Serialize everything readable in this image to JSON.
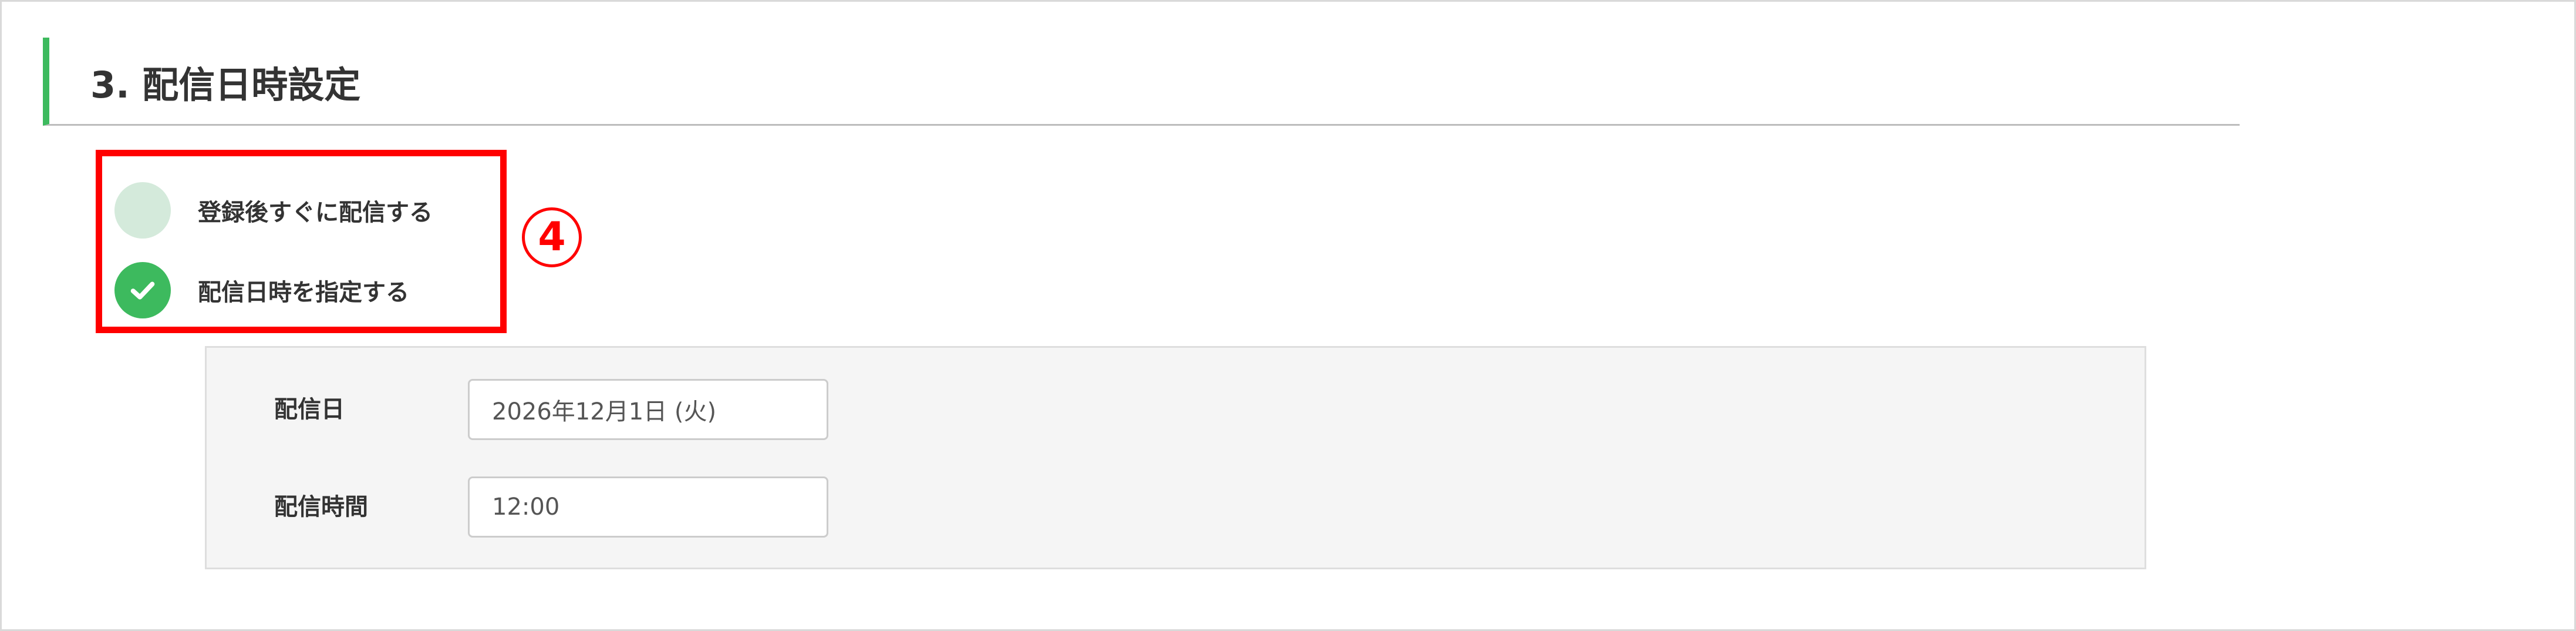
{
  "section": {
    "title": "3. 配信日時設定"
  },
  "delivery_options": [
    {
      "label": "登録後すぐに配信する",
      "selected": false
    },
    {
      "label": "配信日時を指定する",
      "selected": true
    }
  ],
  "annotation": {
    "marker": "④"
  },
  "schedule": {
    "date_label": "配信日",
    "date_value": "2026年12月1日 (火)",
    "time_label": "配信時間",
    "time_value": "12:00"
  },
  "colors": {
    "accent_green": "#3dba5e",
    "radio_unselected": "#d4eadb",
    "highlight_red": "#ff0000"
  },
  "icons": {
    "selected_option": "check-icon"
  }
}
